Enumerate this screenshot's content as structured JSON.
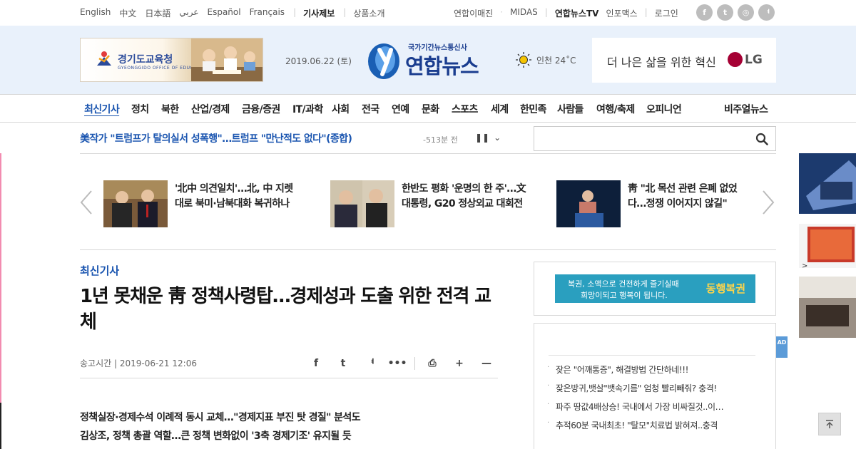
{
  "topbar": {
    "languages": [
      "English",
      "中文",
      "日本語",
      "عربي",
      "Español",
      "Français"
    ],
    "report_link": "기사제보",
    "products_link": "상품소개",
    "util_links": [
      "연합이매진",
      "MIDAS",
      "연합뉴스TV",
      "인포맥스",
      "로그인"
    ],
    "util_seps": [
      "·",
      "|",
      "|"
    ],
    "social_icons": [
      "facebook-icon",
      "twitter-icon",
      "instagram-icon",
      "kakaostory-icon"
    ],
    "social_glyphs": [
      "f",
      "t",
      "◎",
      "ᅧ"
    ]
  },
  "header": {
    "ad_left": {
      "title": "경기도교육청",
      "subtitle": "GYEONGGIDO OFFICE OF EDUCATION"
    },
    "date": "2019.06.22 (토)",
    "logo_sub": "국가기간뉴스통신사",
    "logo_name": "연합뉴스",
    "weather": "인천 24˚C",
    "ad_right": {
      "text": "더 나은 삶을 위한 혁신",
      "brand": "LG"
    }
  },
  "nav": {
    "items": [
      "최신기사",
      "정치",
      "북한",
      "산업/경제",
      "금융/증권",
      "IT/과학",
      "사회",
      "전국",
      "연예",
      "문화",
      "스포츠",
      "세계",
      "한민족",
      "사람들",
      "여행/축제",
      "오피니언"
    ],
    "right": "비주얼뉴스",
    "active_index": 0
  },
  "ticker": {
    "headline": "美작가 \"트럼프가 탈의실서 성폭행\"…트럼프 \"만난적도 없다\"(종합)",
    "time": "-513분 전",
    "pause_glyph": "❚❚",
    "down_glyph": "⌄"
  },
  "search": {
    "placeholder": ""
  },
  "carousel": [
    {
      "title": "'北中 의견일치'…北, 中 지렛대로 북미·남북대화 복귀하나"
    },
    {
      "title": "한반도 평화 '운명의 한 주'…文대통령, G20 정상외교 대회전"
    },
    {
      "title": "靑 \"北 목선 관련 은폐 없었다…정쟁 이어지지 않길\""
    }
  ],
  "article": {
    "section": "최신기사",
    "headline": "1년 못채운 靑 정책사령탑…경제성과 도출 위한 전격 교체",
    "published": "송고시간 | 2019-06-21 12:06",
    "tools": [
      "facebook-icon",
      "twitter-icon",
      "kakaostory-icon",
      "more-icon",
      "print-icon",
      "zoom-in-icon",
      "zoom-out-icon"
    ],
    "tool_glyphs": [
      "f",
      "t",
      "ᅧ",
      "•••",
      "⎙",
      "+",
      "—"
    ],
    "summary": [
      "정책실장·경제수석 이례적 동시 교체…\"경제지표 부진 탓 경질\" 분석도",
      "김상조, 정책 총괄 역할…큰 정책 변화없이 '3축 경제기조' 유지될 듯"
    ]
  },
  "sidebar": {
    "lotto": {
      "line1": "복권, 소액으로 건전하게 즐기실때",
      "line2": "희망이되고 행복이 됩니다.",
      "brand": "동행복권"
    },
    "ad_links": [
      "잦은 \"어깨통증\", 해결방법 간단하네!!!",
      "잦은방귀,뱃살\"뱃속기름\" 엄청 빨리빼줘? 충격!",
      "파주 땅값4배상승! 국내에서 가장 비싸질것..이…",
      "추적60분 국내최초! \"탈모\"치료법 밝혀져..충격"
    ],
    "ad_tag": "AD"
  },
  "colors": {
    "brand_blue": "#1a3d8f",
    "link_blue": "#1a55b0",
    "header_bg": "#e9f1fb",
    "lotto_bg": "#2a9fbf",
    "lg_red": "#a50034"
  }
}
